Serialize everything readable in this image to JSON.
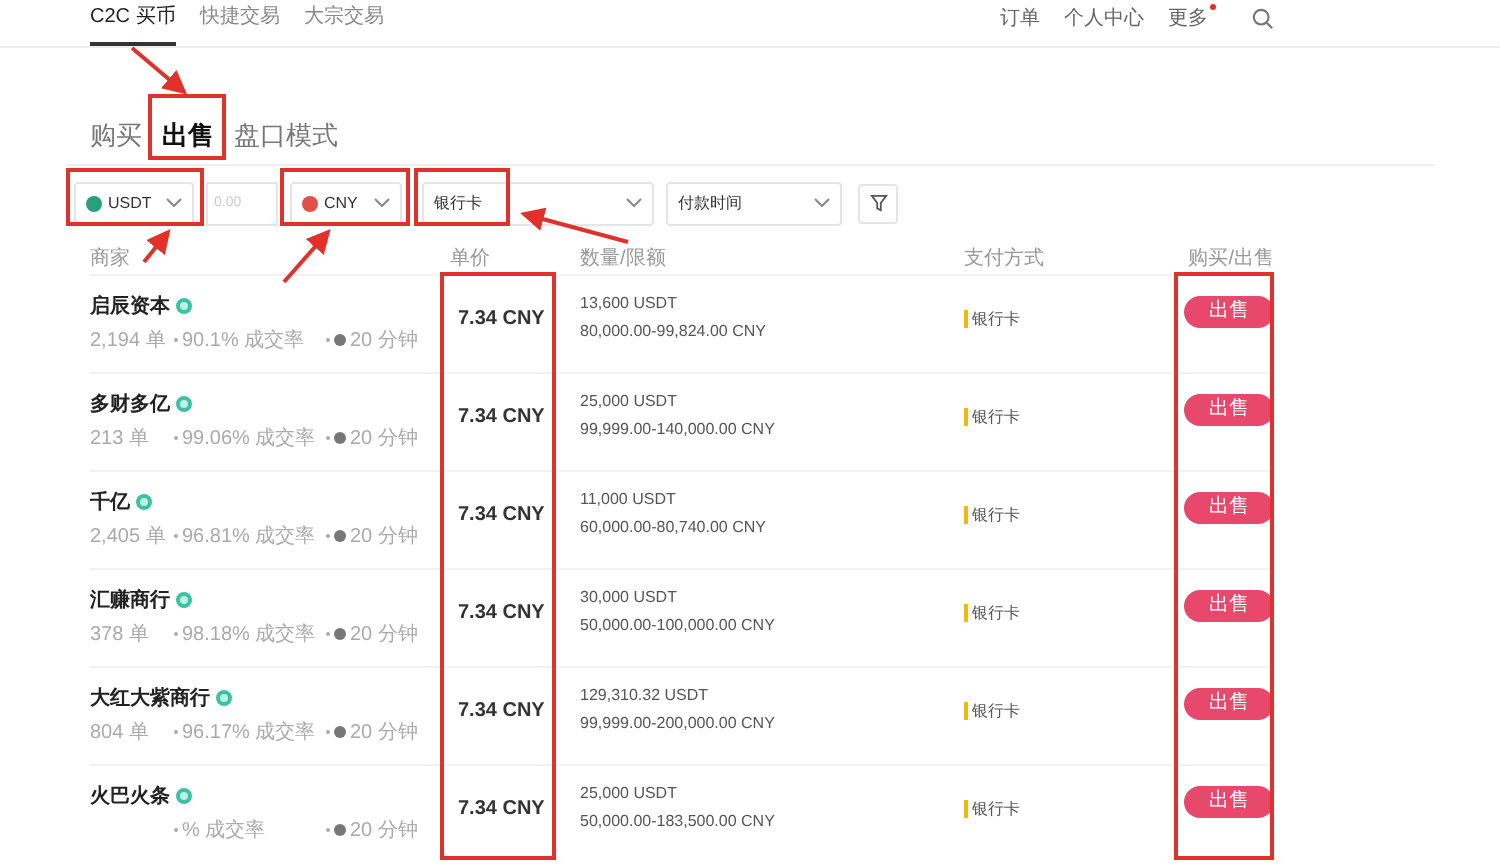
{
  "nav": {
    "left": [
      {
        "label": "C2C 买币",
        "selected": true
      },
      {
        "label": "快捷交易",
        "selected": false
      },
      {
        "label": "大宗交易",
        "selected": false
      }
    ],
    "right": [
      {
        "label": "订单",
        "dot": false
      },
      {
        "label": "个人中心",
        "dot": false
      },
      {
        "label": "更多",
        "dot": true
      }
    ]
  },
  "tabs": [
    {
      "label": "购买",
      "selected": false
    },
    {
      "label": "出售",
      "selected": true
    },
    {
      "label": "盘口模式",
      "selected": false
    }
  ],
  "filters": {
    "coin": {
      "value": "USDT"
    },
    "amount": {
      "placeholder": "0.00"
    },
    "fiat": {
      "value": "CNY"
    },
    "payment": {
      "value": "银行卡"
    },
    "time": {
      "value": "付款时间"
    }
  },
  "table": {
    "columns": [
      "商家",
      "单价",
      "数量/限额",
      "支付方式",
      "购买/出售"
    ],
    "rows": [
      {
        "name": "启辰资本",
        "verified": true,
        "orders": "2,194 单",
        "rate": "90.1% 成交率",
        "time": "20 分钟",
        "price": "7.34 CNY",
        "quantity": "13,600 USDT",
        "limits": "80,000.00-99,824.00 CNY",
        "payment": "银行卡",
        "action": "出售"
      },
      {
        "name": "多财多亿",
        "verified": true,
        "orders": "213 单",
        "rate": "99.06% 成交率",
        "time": "20 分钟",
        "price": "7.34 CNY",
        "quantity": "25,000 USDT",
        "limits": "99,999.00-140,000.00 CNY",
        "payment": "银行卡",
        "action": "出售"
      },
      {
        "name": "千亿",
        "verified": true,
        "orders": "2,405 单",
        "rate": "96.81% 成交率",
        "time": "20 分钟",
        "price": "7.34 CNY",
        "quantity": "11,000 USDT",
        "limits": "60,000.00-80,740.00 CNY",
        "payment": "银行卡",
        "action": "出售"
      },
      {
        "name": "汇赚商行",
        "verified": true,
        "orders": "378 单",
        "rate": "98.18% 成交率",
        "time": "20 分钟",
        "price": "7.34 CNY",
        "quantity": "30,000 USDT",
        "limits": "50,000.00-100,000.00 CNY",
        "payment": "银行卡",
        "action": "出售"
      },
      {
        "name": "大红大紫商行",
        "verified": true,
        "orders": "804 单",
        "rate": "96.17% 成交率",
        "time": "20 分钟",
        "price": "7.34 CNY",
        "quantity": "129,310.32 USDT",
        "limits": "99,999.00-200,000.00 CNY",
        "payment": "银行卡",
        "action": "出售"
      },
      {
        "name": "火巴火条",
        "verified": true,
        "rate": "% 成交率",
        "time": "20 分钟",
        "price": "7.34 CNY",
        "quantity": "25,000 USDT",
        "limits": "50,000.00-183,500.00 CNY",
        "payment": "银行卡",
        "action": "出售"
      }
    ]
  }
}
